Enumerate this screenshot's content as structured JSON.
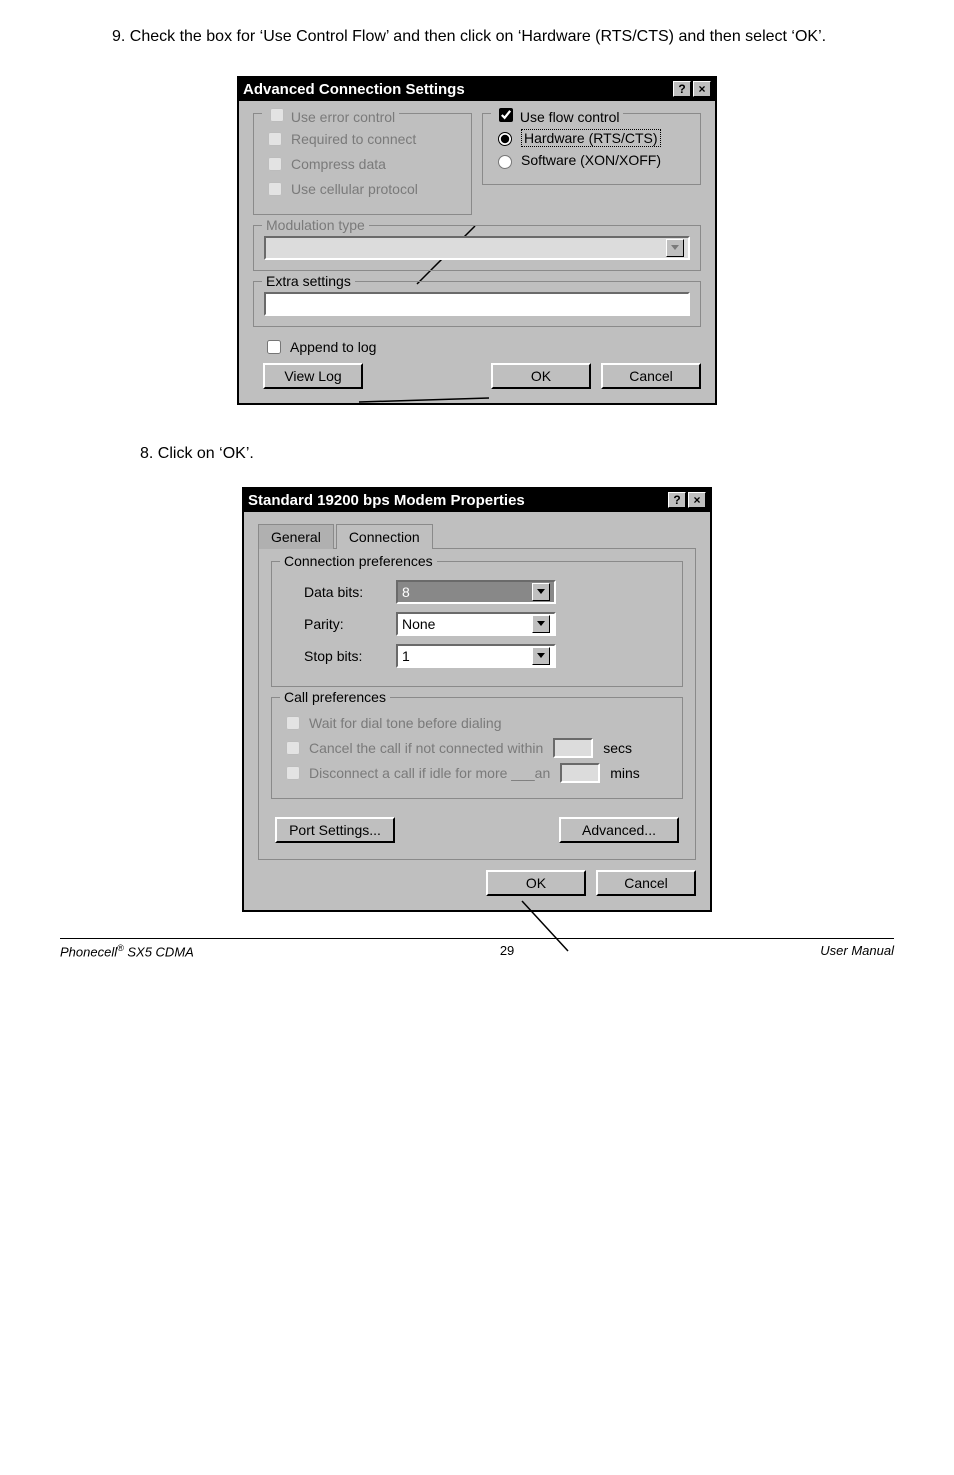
{
  "instructions": {
    "step9": "9. Check the box for ‘Use Control Flow’ and then click on ‘Hardware (RTS/CTS) and then select ‘OK’.",
    "step8": "8.  Click on ‘OK’."
  },
  "dialog1": {
    "title": "Advanced Connection Settings",
    "help_icon": "?",
    "close_icon": "×",
    "error_control": {
      "legend": "Use error control",
      "required": "Required to connect",
      "compress": "Compress data",
      "cellular": "Use cellular protocol"
    },
    "flow_control": {
      "legend": "Use flow control",
      "hardware": "Hardware (RTS/CTS)",
      "software": "Software (XON/XOFF)"
    },
    "modulation": {
      "legend": "Modulation type"
    },
    "extra": {
      "legend": "Extra settings"
    },
    "append_log": "Append to log",
    "view_log": "View Log",
    "ok": "OK",
    "cancel": "Cancel"
  },
  "dialog2": {
    "title": "Standard 19200 bps Modem Properties",
    "help_icon": "?",
    "close_icon": "×",
    "tabs": {
      "general": "General",
      "connection": "Connection"
    },
    "conn_pref": {
      "legend": "Connection preferences",
      "data_bits_label": "Data bits:",
      "data_bits_value": "8",
      "parity_label": "Parity:",
      "parity_value": "None",
      "stop_bits_label": "Stop bits:",
      "stop_bits_value": "1"
    },
    "call_pref": {
      "legend": "Call preferences",
      "wait_dial": "Wait for dial tone before dialing",
      "cancel_call": "Cancel the call if not connected within",
      "cancel_unit": "secs",
      "disconnect": "Disconnect a call if idle for more ___an",
      "disconnect_unit": "mins"
    },
    "port_settings": "Port Settings...",
    "advanced": "Advanced...",
    "ok": "OK",
    "cancel": "Cancel"
  },
  "footer": {
    "brand": "Phonecell",
    "reg": "®",
    "model": " SX5 CDMA",
    "page": "29",
    "doc": "User Manual"
  }
}
